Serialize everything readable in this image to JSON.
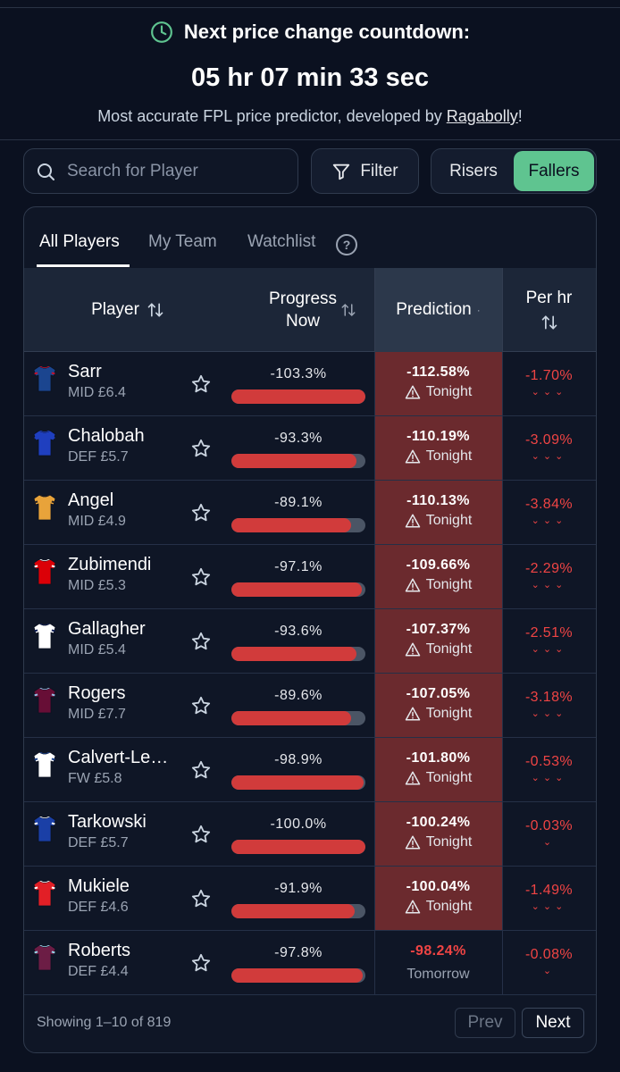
{
  "countdown": {
    "label": "Next price change countdown:",
    "time": "05 hr 07 min 33 sec",
    "subtitle_prefix": "Most accurate FPL price predictor, developed by ",
    "subtitle_link": "Ragabolly",
    "subtitle_suffix": "!"
  },
  "search": {
    "placeholder": "Search for Player"
  },
  "filter": {
    "label": "Filter"
  },
  "toggle": {
    "risers": "Risers",
    "fallers": "Fallers",
    "active": "fallers",
    "active_color": "#5fc490"
  },
  "tabs": [
    {
      "label": "All Players",
      "active": true
    },
    {
      "label": "My Team",
      "active": false
    },
    {
      "label": "Watchlist",
      "active": false
    }
  ],
  "help_icon": "?",
  "columns": {
    "player": "Player",
    "progress_line1": "Progress",
    "progress_line2": "Now",
    "prediction": "Prediction",
    "prediction_sort": "·",
    "per_hr": "Per hr"
  },
  "players": [
    {
      "name": "Sarr",
      "meta": "MID £6.4",
      "progress": "-103.3%",
      "progress_fraction": 1.0,
      "prediction": "-112.58%",
      "when": "Tonight",
      "per_hr": "-1.70%",
      "arrows": "⌄⌄⌄",
      "kit": "crystal-palace",
      "kit_primary": "#1b458f",
      "kit_secondary": "#c4122e"
    },
    {
      "name": "Chalobah",
      "meta": "DEF £5.7",
      "progress": "-93.3%",
      "progress_fraction": 0.933,
      "prediction": "-110.19%",
      "when": "Tonight",
      "per_hr": "-3.09%",
      "arrows": "⌄⌄⌄",
      "kit": "chelsea",
      "kit_primary": "#1f3fbf",
      "kit_secondary": "#1f3fbf"
    },
    {
      "name": "Angel",
      "meta": "MID £4.9",
      "progress": "-89.1%",
      "progress_fraction": 0.891,
      "prediction": "-110.13%",
      "when": "Tonight",
      "per_hr": "-3.84%",
      "arrows": "⌄⌄⌄",
      "kit": "wolves",
      "kit_primary": "#e8a33a",
      "kit_secondary": "#231f20"
    },
    {
      "name": "Zubimendi",
      "meta": "MID £5.3",
      "progress": "-97.1%",
      "progress_fraction": 0.971,
      "prediction": "-109.66%",
      "when": "Tonight",
      "per_hr": "-2.29%",
      "arrows": "⌄⌄⌄",
      "kit": "arsenal",
      "kit_primary": "#db0007",
      "kit_secondary": "#ffffff"
    },
    {
      "name": "Gallagher",
      "meta": "MID £5.4",
      "progress": "-93.6%",
      "progress_fraction": 0.936,
      "prediction": "-107.37%",
      "when": "Tonight",
      "per_hr": "-2.51%",
      "arrows": "⌄⌄⌄",
      "kit": "tottenham",
      "kit_primary": "#ffffff",
      "kit_secondary": "#132257"
    },
    {
      "name": "Rogers",
      "meta": "MID £7.7",
      "progress": "-89.6%",
      "progress_fraction": 0.896,
      "prediction": "-107.05%",
      "when": "Tonight",
      "per_hr": "-3.18%",
      "arrows": "⌄⌄⌄",
      "kit": "aston-villa",
      "kit_primary": "#670e36",
      "kit_secondary": "#95bfe5"
    },
    {
      "name": "Calvert-Lewin",
      "meta": "FW £5.8",
      "progress": "-98.9%",
      "progress_fraction": 0.989,
      "prediction": "-101.80%",
      "when": "Tonight",
      "per_hr": "-0.53%",
      "arrows": "⌄⌄⌄",
      "kit": "leeds",
      "kit_primary": "#ffffff",
      "kit_secondary": "#1d428a"
    },
    {
      "name": "Tarkowski",
      "meta": "DEF £5.7",
      "progress": "-100.0%",
      "progress_fraction": 1.0,
      "prediction": "-100.24%",
      "when": "Tonight",
      "per_hr": "-0.03%",
      "arrows": "⌄",
      "kit": "everton",
      "kit_primary": "#1a3fa6",
      "kit_secondary": "#ffffff"
    },
    {
      "name": "Mukiele",
      "meta": "DEF £4.6",
      "progress": "-91.9%",
      "progress_fraction": 0.919,
      "prediction": "-100.04%",
      "when": "Tonight",
      "per_hr": "-1.49%",
      "arrows": "⌄⌄⌄",
      "kit": "sunderland",
      "kit_primary": "#e21f26",
      "kit_secondary": "#ffffff"
    },
    {
      "name": "Roberts",
      "meta": "DEF £4.4",
      "progress": "-97.8%",
      "progress_fraction": 0.978,
      "prediction": "-98.24%",
      "when": "Tomorrow",
      "per_hr": "-0.08%",
      "arrows": "⌄",
      "kit": "burnley",
      "kit_primary": "#6c1d45",
      "kit_secondary": "#99d6ea"
    }
  ],
  "pagination": {
    "showing": "Showing 1–10 of 819",
    "prev": "Prev",
    "next": "Next"
  },
  "colors": {
    "background": "#0b1120",
    "danger": "#ef4444",
    "hot_cell": "#6b2a2e",
    "accent": "#5fc490"
  }
}
